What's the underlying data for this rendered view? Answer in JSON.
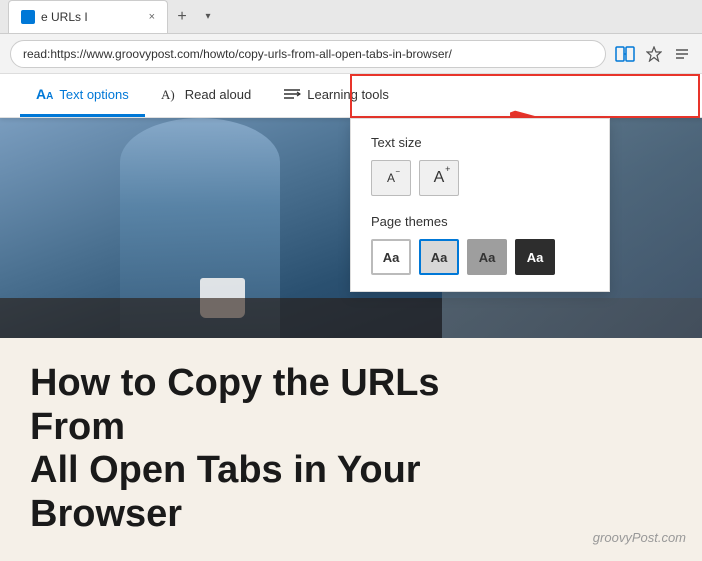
{
  "browser": {
    "tab": {
      "title": "e URLs I",
      "close_label": "×"
    },
    "tab_new_label": "+",
    "tab_dropdown_label": "▾",
    "address_bar": {
      "url_prefix": "read:https://",
      "url_domain": "www.groovypost.com",
      "url_path": "/howto/copy-urls-from-all-open-tabs-in-browser/"
    }
  },
  "reader_toolbar": {
    "text_options_label": "Text options",
    "read_aloud_label": "Read aloud",
    "learning_tools_label": "Learning tools"
  },
  "text_options_panel": {
    "text_size_label": "Text size",
    "decrease_label": "A",
    "increase_label": "A",
    "page_themes_label": "Page themes",
    "themes": [
      {
        "label": "Aa",
        "type": "white"
      },
      {
        "label": "Aa",
        "type": "light-gray"
      },
      {
        "label": "Aa",
        "type": "gray"
      },
      {
        "label": "Aa",
        "type": "dark"
      }
    ]
  },
  "article": {
    "title_line1": "How to Copy the URLs From",
    "title_line2": "All Open Tabs in Your",
    "title_line3": "Browser"
  },
  "watermark": {
    "text": "groovyPost.com"
  }
}
